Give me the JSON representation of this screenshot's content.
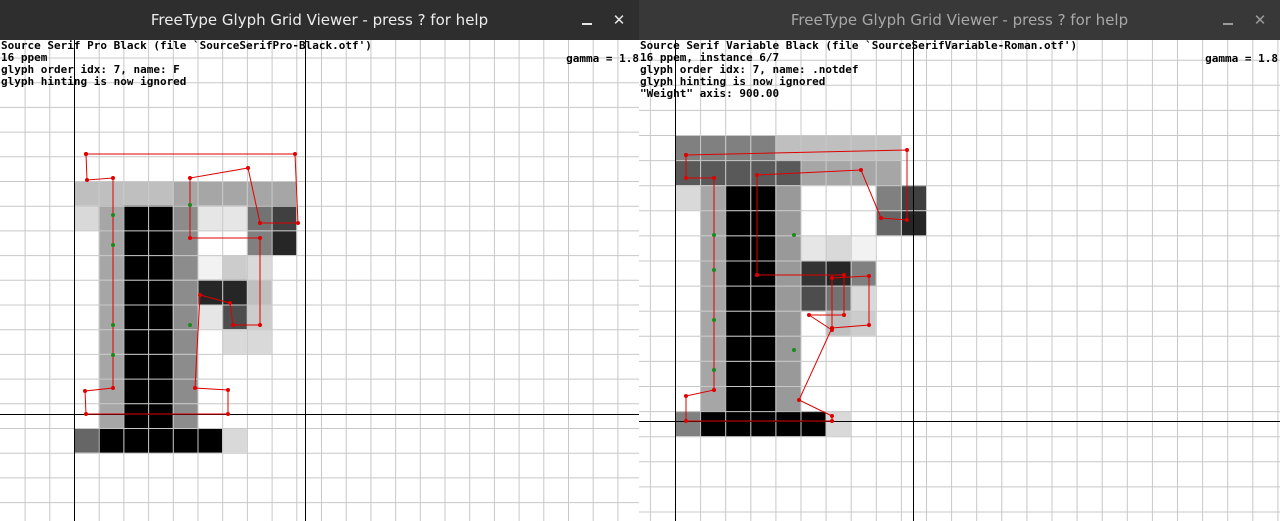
{
  "windows": [
    {
      "title": "FreeType Glyph Grid Viewer - press ? for help",
      "minimize_glyph": "minimize-icon",
      "close_glyph": "✕",
      "info_lines": [
        "Source Serif Pro Black (file `SourceSerifPro-Black.otf')",
        "16 ppem",
        "glyph order idx: 7, name: F",
        "glyph hinting is now ignored"
      ],
      "gamma": "gamma = 1.8"
    },
    {
      "title": "FreeType Glyph Grid Viewer - press ? for help",
      "minimize_glyph": "minimize-icon",
      "close_glyph": "✕",
      "info_lines": [
        "Source Serif Variable Black (file `SourceSerifVariable-Roman.otf')",
        "16 ppem, instance 6/7",
        "glyph order idx: 7, name: .notdef",
        "glyph hinting is now ignored",
        "\"Weight\" axis: 900.00"
      ],
      "gamma": "gamma = 1.8"
    }
  ],
  "colors": {
    "grid": "#c8c8c8",
    "axis": "#000000",
    "outline": "#e00000",
    "on_point": "#e00000",
    "off_point": "#1a8a1a"
  }
}
